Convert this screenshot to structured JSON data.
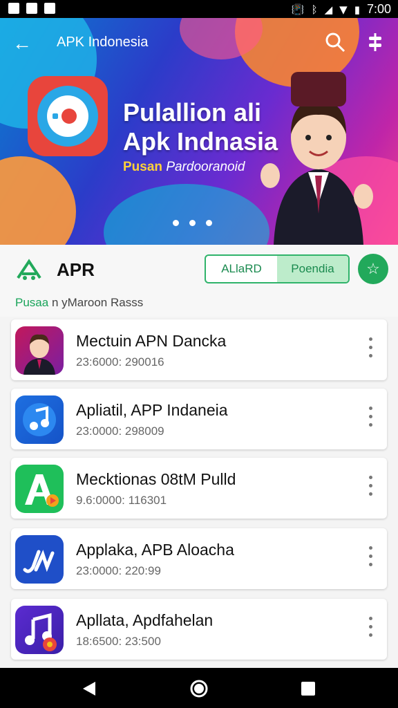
{
  "status_bar": {
    "time": "7:00"
  },
  "app_bar": {
    "title": "APK Indonesia"
  },
  "banner": {
    "title_line1": "Pulallion ali",
    "title_line2": "Apk Indnasia",
    "subtitle_bold": "Pusan",
    "subtitle_rest": "Pardooranoid"
  },
  "section": {
    "title": "APR",
    "toggle_left": "ALlaRD",
    "toggle_right": "Poendia",
    "subtitle_accent": "Pusaa",
    "subtitle_rest": "n yMaroon Rasss"
  },
  "apps": [
    {
      "name": "Mectuin APN Dancka",
      "meta": "23:6000: 290016",
      "icon": "avatar-icon"
    },
    {
      "name": "Apliatil, APP Indaneia",
      "meta": "23:0000: 298009",
      "icon": "music-note-icon"
    },
    {
      "name": "Mecktionas 08tM Pulld",
      "meta": "9.6:0000: 116301",
      "icon": "letter-a-icon"
    },
    {
      "name": "Applaka, APB  Aloacha",
      "meta": "23:0000: 220:99",
      "icon": "pen-icon"
    },
    {
      "name": "Apllata, Apdfahelan",
      "meta": "18:6500: 23:500",
      "icon": "music-note-icon"
    }
  ],
  "colors": {
    "accent": "#22a95b",
    "banner_start": "#0a7fcf",
    "banner_end": "#f0458a"
  }
}
